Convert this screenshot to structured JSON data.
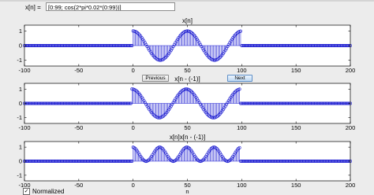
{
  "expression": {
    "label": "x[n] =",
    "value": "[0:99; cos(2*pi*0.02*(0:99))]"
  },
  "buttons": {
    "previous": "Previous",
    "next": "Next"
  },
  "normalized": {
    "label": "Normalized",
    "checked": true
  },
  "colors": {
    "stem": "#1f1fd1",
    "fill": "#a9a9ff",
    "axes_bg": "#ffffff"
  },
  "chart_data": [
    {
      "type": "stem",
      "title": "x[n]",
      "xlim": [
        -100,
        200
      ],
      "ylim": [
        -1.4,
        1.4
      ],
      "xticks": [
        -100,
        -50,
        0,
        50,
        100,
        150,
        200
      ],
      "yticks": [
        -1,
        0,
        1
      ],
      "signal": "cos(2*pi*0.02*n), n = 0..99, zero elsewhere"
    },
    {
      "type": "stem",
      "title": "x[n - (-1)]",
      "xlim": [
        -100,
        200
      ],
      "ylim": [
        -1.4,
        1.4
      ],
      "xticks": [
        -100,
        -50,
        0,
        50,
        100,
        150,
        200
      ],
      "yticks": [
        -1,
        0,
        1
      ],
      "signal": "cos(2*pi*0.02*(n+1)), n = -1..98, zero elsewhere"
    },
    {
      "type": "stem",
      "title": "x[n]x[n - (-1)]",
      "xlabel": "n",
      "xlim": [
        -100,
        200
      ],
      "ylim": [
        -1.4,
        1.4
      ],
      "xticks": [
        -100,
        -50,
        0,
        50,
        100,
        150,
        200
      ],
      "yticks": [
        -1,
        0,
        1
      ],
      "signal": "cos(2*pi*0.02*n)*cos(2*pi*0.02*(n+1)), n = 0..98, zero elsewhere"
    }
  ]
}
